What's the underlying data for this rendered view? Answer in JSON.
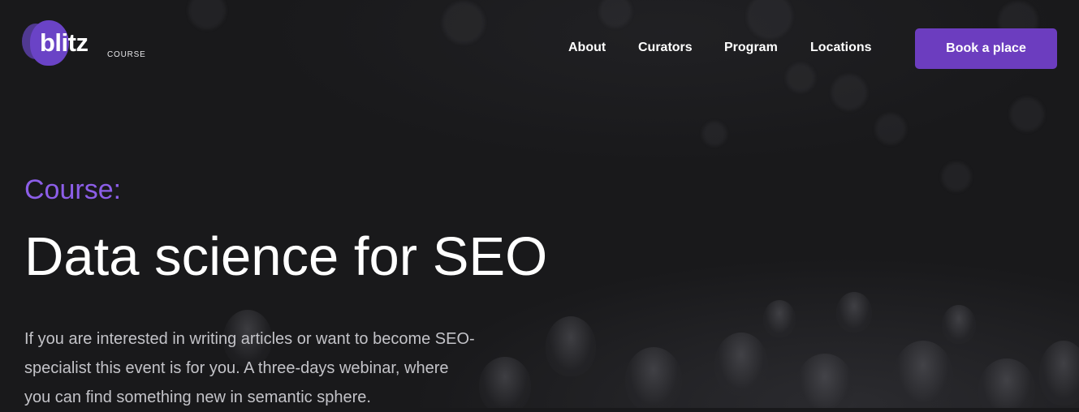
{
  "brand": {
    "name": "blitz",
    "tagline": "COURSE"
  },
  "nav": {
    "items": [
      {
        "id": "about",
        "label": "About"
      },
      {
        "id": "curators",
        "label": "Curators"
      },
      {
        "id": "program",
        "label": "Program"
      },
      {
        "id": "locations",
        "label": "Locations"
      }
    ],
    "cta_label": "Book a place"
  },
  "hero": {
    "eyebrow": "Course:",
    "title": "Data science for SEO",
    "description": "If you are interested in writing articles or want to become SEO-specialist this event is for you. A three-days webinar, where you can find something new in semantic sphere."
  },
  "colors": {
    "accent": "#6c3dbf",
    "eyebrow": "#8c5ee8",
    "background": "#19191b"
  }
}
